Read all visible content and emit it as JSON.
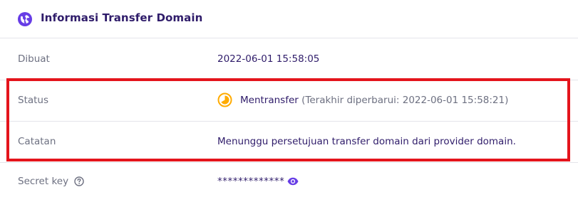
{
  "header": {
    "title": "Informasi Transfer Domain",
    "icon": "globe-icon"
  },
  "rows": {
    "created": {
      "label": "Dibuat",
      "value": "2022-06-01 15:58:05"
    },
    "status": {
      "label": "Status",
      "value": "Mentransfer",
      "detail": "(Terakhir diperbarui: 2022-06-01 15:58:21)",
      "icon": "clock-pending-icon"
    },
    "note": {
      "label": "Catatan",
      "value": "Menunggu persetujuan transfer domain dari provider domain."
    },
    "secret": {
      "label": "Secret key",
      "value": "*************",
      "help_icon": "question-circle-icon",
      "toggle_icon": "eye-icon"
    }
  },
  "colors": {
    "brand": "#673de6",
    "title": "#2f1c6a",
    "label": "#6d7081",
    "status_warning": "#ffab00",
    "highlight": "#e4141c"
  }
}
